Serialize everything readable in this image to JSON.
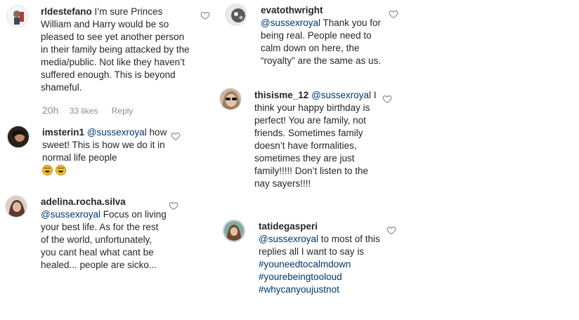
{
  "comments": [
    {
      "username": "rldestefano",
      "text": "I’m sure Princes William and Harry would be so pleased to see yet another person in their family being attacked by the media/public. Not like they haven’t suffered enough. This is beyond shameful.",
      "time": "20h",
      "likes": "33 likes",
      "reply": "Reply"
    },
    {
      "username": "imsterin1",
      "mention": "@sussexroyal",
      "text": "how sweet! This is how we do it in normal life people",
      "emojis": [
        "grinning-squint-face-emoji",
        "grinning-squint-face-emoji"
      ]
    },
    {
      "username": "adelina.rocha.silva",
      "mention": "@sussexroyal",
      "text": "Focus on living your best life. As for the rest of the world, unfortunately, you cant heal what cant be healed... people are sicko..."
    },
    {
      "username": "evatothwright",
      "mention": "@sussexroyal",
      "text": "Thank you for being real. People need to calm down on here, the “royalty” are the same as us."
    },
    {
      "username": "thisisme_12",
      "mention": "@sussexroyal",
      "text": "I think your happy birthday is perfect! You are family, not friends. Sometimes family doesn’t have formalities, sometimes they are just family!!!!! Don’t listen to the nay sayers!!!!"
    },
    {
      "username": "tatidegasperi",
      "mention": "@sussexroyal",
      "text": "to most of this replies all I want to say is",
      "hashtags": [
        "#youneedtocalmdown",
        "#yourebeingtooloud",
        "#whycanyoujustnot"
      ]
    }
  ],
  "colors": {
    "link": "#00376b",
    "muted": "#8e8e8e",
    "text": "#262626"
  },
  "icons": {
    "like": "heart-outline-icon"
  }
}
